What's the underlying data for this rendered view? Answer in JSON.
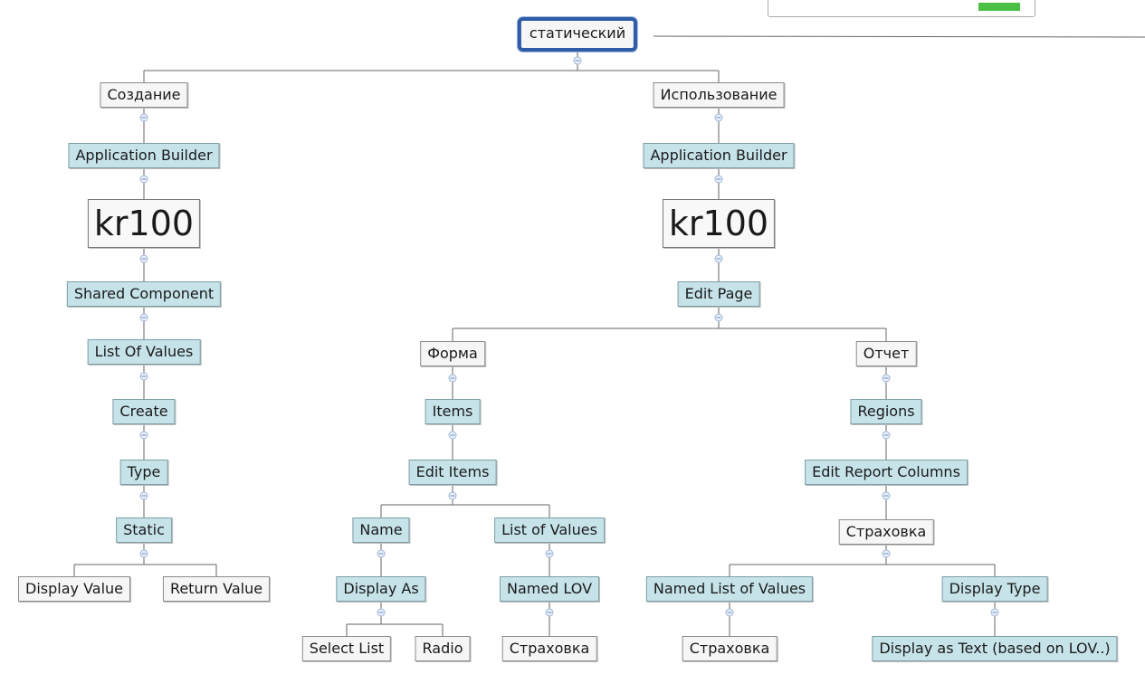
{
  "nodes": {
    "root": "статический",
    "create": "Создание",
    "create_app_builder": "Application Builder",
    "create_kr100": "kr100",
    "shared_component": "Shared Component",
    "list_of_values_left": "List Of Values",
    "create_btn": "Create",
    "type": "Type",
    "static": "Static",
    "display_value": "Display Value",
    "return_value": "Return Value",
    "use": "Использование",
    "use_app_builder": "Application Builder",
    "use_kr100": "kr100",
    "edit_page": "Edit Page",
    "form": "Форма",
    "items": "Items",
    "edit_items": "Edit Items",
    "name": "Name",
    "display_as": "Display As",
    "select_list": "Select List",
    "radio": "Radio",
    "list_of_values_mid": "List of Values",
    "named_lov": "Named LOV",
    "insurance_1": "Страховка",
    "report": "Отчет",
    "regions": "Regions",
    "edit_report_columns": "Edit Report Columns",
    "insurance_2": "Страховка",
    "named_list_of_values": "Named List of Values",
    "insurance_3": "Страховка",
    "display_type": "Display Type",
    "display_as_text": "Display as Text (based on LOV..)"
  },
  "colors": {
    "edge": "#666666",
    "node_plain": "#f6f6f6",
    "node_cyan": "#c7e3ea",
    "root_border": "#2f5ca8"
  }
}
